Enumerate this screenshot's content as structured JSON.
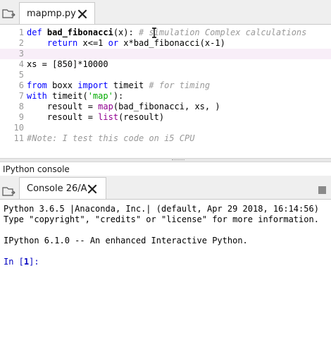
{
  "editor": {
    "tab_label": "mapmp.py",
    "lines": [
      {
        "num": "1",
        "parts": [
          [
            "kw",
            "def "
          ],
          [
            "fn",
            "bad_fibonacci"
          ],
          [
            "plain",
            "(x): "
          ],
          [
            "cm",
            "# simulation Complex calculations"
          ]
        ]
      },
      {
        "num": "2",
        "parts": [
          [
            "plain",
            "    "
          ],
          [
            "kw",
            "return"
          ],
          [
            "plain",
            " x<=1 "
          ],
          [
            "kw",
            "or"
          ],
          [
            "plain",
            " x*bad_fibonacci(x-1)"
          ]
        ]
      },
      {
        "num": "3",
        "parts": []
      },
      {
        "num": "4",
        "parts": [
          [
            "plain",
            "xs = [850]*10000"
          ]
        ]
      },
      {
        "num": "5",
        "parts": []
      },
      {
        "num": "6",
        "parts": [
          [
            "kw",
            "from"
          ],
          [
            "plain",
            " boxx "
          ],
          [
            "kw",
            "import"
          ],
          [
            "plain",
            " timeit "
          ],
          [
            "cm",
            "# for timing"
          ]
        ]
      },
      {
        "num": "7",
        "parts": [
          [
            "kw",
            "with"
          ],
          [
            "plain",
            " timeit("
          ],
          [
            "str",
            "'map'"
          ],
          [
            "plain",
            "):"
          ]
        ]
      },
      {
        "num": "8",
        "parts": [
          [
            "plain",
            "    resoult = "
          ],
          [
            "bi",
            "map"
          ],
          [
            "plain",
            "(bad_fibonacci, xs, )"
          ]
        ]
      },
      {
        "num": "9",
        "parts": [
          [
            "plain",
            "    resoult = "
          ],
          [
            "bi",
            "list"
          ],
          [
            "plain",
            "(resoult)"
          ]
        ]
      },
      {
        "num": "10",
        "parts": []
      },
      {
        "num": "11",
        "parts": [
          [
            "cm",
            "#Note: I test this code on i5 CPU"
          ]
        ]
      }
    ],
    "current_line_index": 2
  },
  "console_pane": {
    "title": "IPython console",
    "tab_label": "Console 26/A",
    "lines": [
      "Python 3.6.5 |Anaconda, Inc.| (default, Apr 29 2018, 16:14:56)",
      "Type \"copyright\", \"credits\" or \"license\" for more information.",
      "",
      "IPython 6.1.0 -- An enhanced Interactive Python.",
      ""
    ],
    "prompt": {
      "prefix": "In [",
      "number": "1",
      "suffix": "]: "
    }
  },
  "icons": {
    "folder": "folder-icon",
    "close": "close-icon",
    "text_cursor": "text-cursor-icon",
    "options": "options-icon"
  }
}
